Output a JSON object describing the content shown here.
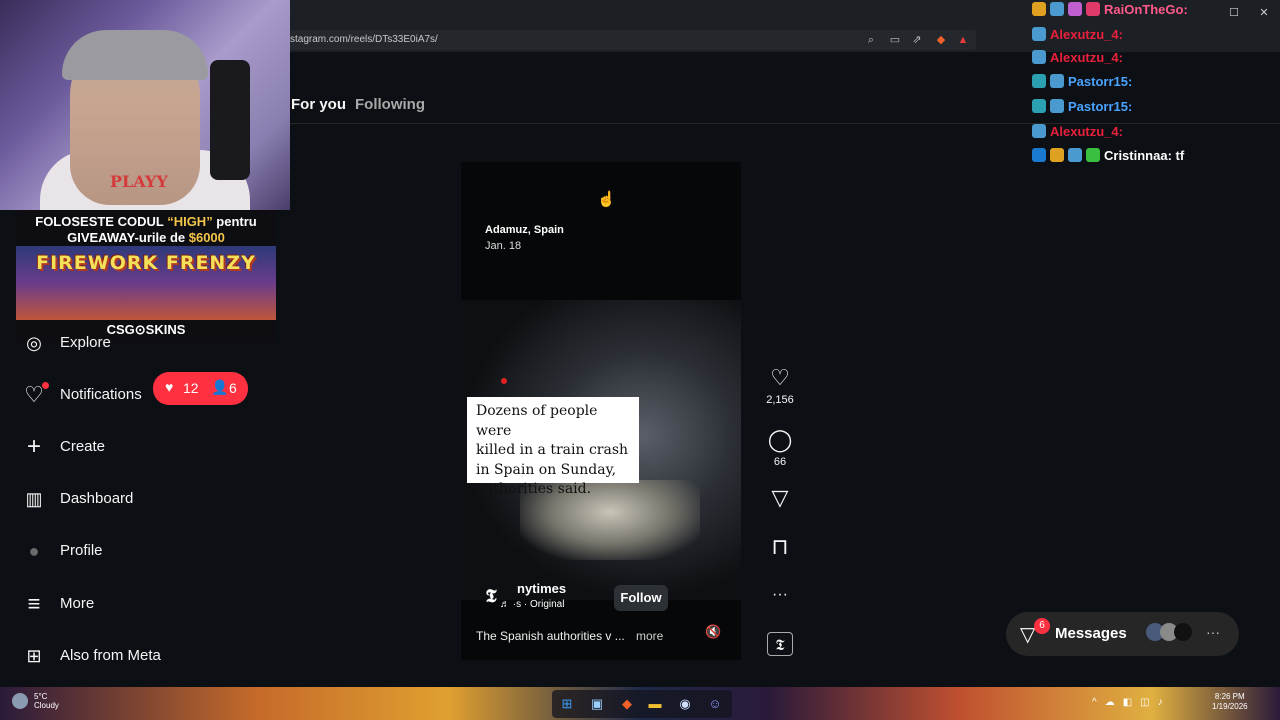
{
  "browser": {
    "url": "stagram.com/reels/DTs33E0iA7s/",
    "controls": {
      "minimize": "─",
      "maximize": "☐",
      "close": "✕"
    }
  },
  "tabs": [
    {
      "label": "For you",
      "active": true
    },
    {
      "label": "Following",
      "active": false
    }
  ],
  "overlay_promo": {
    "line1_pre": "FOLOSESTE CODUL ",
    "line1_code": "“HIGH”",
    "line1_post": " pentru",
    "line2_pre": "GIVEAWAY-urile de ",
    "line2_amount": "$6000",
    "game_title": "FIREWORK FRENZY",
    "brand": "CSG⊙SKINS",
    "shirt_text": "PLAYY"
  },
  "sidebar": {
    "items": [
      {
        "label": "Explore",
        "icon": "compass-icon",
        "glyph": "◎"
      },
      {
        "label": "Notifications",
        "icon": "heart-icon",
        "glyph": "♡"
      },
      {
        "label": "Create",
        "icon": "plus-icon",
        "glyph": "+"
      },
      {
        "label": "Dashboard",
        "icon": "dashboard-icon",
        "glyph": "▥"
      },
      {
        "label": "Profile",
        "icon": "avatar-icon",
        "glyph": "●"
      },
      {
        "label": "More",
        "icon": "menu-icon",
        "glyph": "≡"
      },
      {
        "label": "Also from Meta",
        "icon": "meta-apps-icon",
        "glyph": "⊞"
      }
    ],
    "notifications_badge": {
      "likes": "12",
      "follows": "6",
      "color": "#ff3040"
    }
  },
  "reel": {
    "location": "Adamuz, Spain",
    "date": "Jan. 18",
    "caption_lines": [
      "Dozens of people were",
      "killed in a train crash",
      "in Spain on Sunday,",
      "authorities said."
    ],
    "author": "nytimes",
    "author_logo": "𝕿",
    "audio": "♬ ·s · Original",
    "follow_label": "Follow",
    "description": "The Spanish authorities v ...",
    "more_label": "more",
    "mute_glyph": "🔇"
  },
  "actions": {
    "likes": "2,156",
    "comments": "66",
    "like_glyph": "♡",
    "comment_glyph": "◯",
    "share_glyph": "▽",
    "save_glyph": "⊓",
    "more_glyph": "···",
    "audio_glyph": "𝕿"
  },
  "chat": {
    "messages": [
      {
        "user": "RaiOnTheGo:",
        "text": "",
        "color": "#ff5a8a"
      },
      {
        "user": "Alexutzu_4:",
        "text": "",
        "color": "#e8213c"
      },
      {
        "user": "Alexutzu_4:",
        "text": "",
        "color": "#e8213c"
      },
      {
        "user": "Pastorr15:",
        "text": "",
        "color": "#4aa3ff"
      },
      {
        "user": "Pastorr15:",
        "text": "",
        "color": "#4aa3ff"
      },
      {
        "user": "Alexutzu_4:",
        "text": "",
        "color": "#e8213c"
      },
      {
        "user": "Cristinnaa:",
        "text": "tf",
        "color": "#ffffff"
      }
    ]
  },
  "messages_widget": {
    "label": "Messages",
    "count": "6",
    "more_glyph": "···"
  },
  "taskbar": {
    "weather_temp": "5°C",
    "weather_desc": "Cloudy",
    "time": "8:26 PM",
    "date": "1/19/2026"
  }
}
